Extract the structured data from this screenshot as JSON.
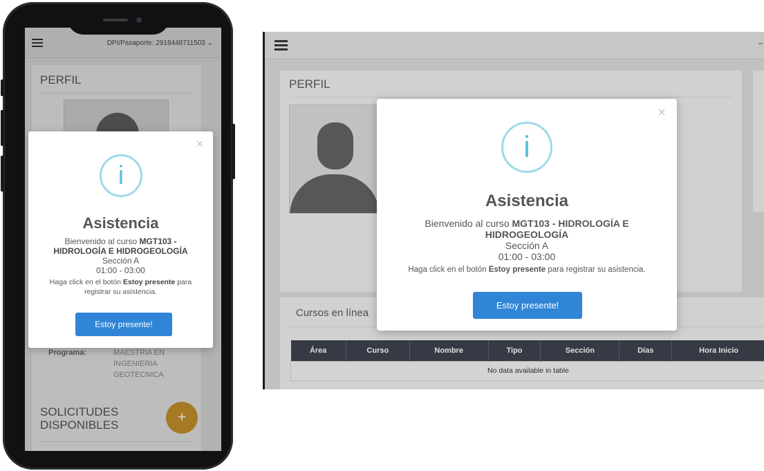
{
  "mobile": {
    "dpi_label": "DPI/Pasaporte: 2918448711503 ⌄",
    "perfil_title": "PERFIL",
    "programa_label": "Programa:",
    "programa_value": "MAESTRIA EN INGENIERIA GEOTECNICA",
    "solicitudes_title": "SOLICITUDES DISPONIBLES",
    "fab_icon": "plus-icon",
    "fab_symbol": "+",
    "modal": {
      "close": "×",
      "icon_symbol": "i",
      "heading": "Asistencia",
      "welcome_prefix": "Bienvenido al curso ",
      "course": "MGT103 - HIDROLOGÍA E HIDROGEOLOGÍA",
      "section": "Sección A",
      "time": "01:00 - 03:00",
      "instruction_prefix": "Haga click en el botón ",
      "instruction_bold": "Estoy presente",
      "instruction_suffix": " para registrar su asistencia.",
      "button": "Estoy presente!"
    }
  },
  "desktop": {
    "perfil_title": "PERFIL",
    "cursos_title": "Cursos en línea",
    "table": {
      "headers": [
        "Área",
        "Curso",
        "Nombre",
        "Tipo",
        "Sección",
        "Días",
        "Hora Inicio"
      ],
      "empty": "No data available in table"
    },
    "modal": {
      "close": "×",
      "icon_symbol": "i",
      "heading": "Asistencia",
      "welcome_prefix": "Bienvenido al curso ",
      "course": "MGT103 - HIDROLOGÍA E HIDROGEOLOGÍA",
      "section": "Sección A",
      "time": "01:00 - 03:00",
      "instruction_prefix": "Haga click en el botón ",
      "instruction_bold": "Estoy presente",
      "instruction_suffix": " para registrar su asistencia.",
      "button": "Estoy presente!"
    }
  },
  "colors": {
    "primary_button": "#3085d6",
    "info_icon": "#5bc0de",
    "fab": "#c9952e",
    "table_header": "#3a3f4a"
  }
}
